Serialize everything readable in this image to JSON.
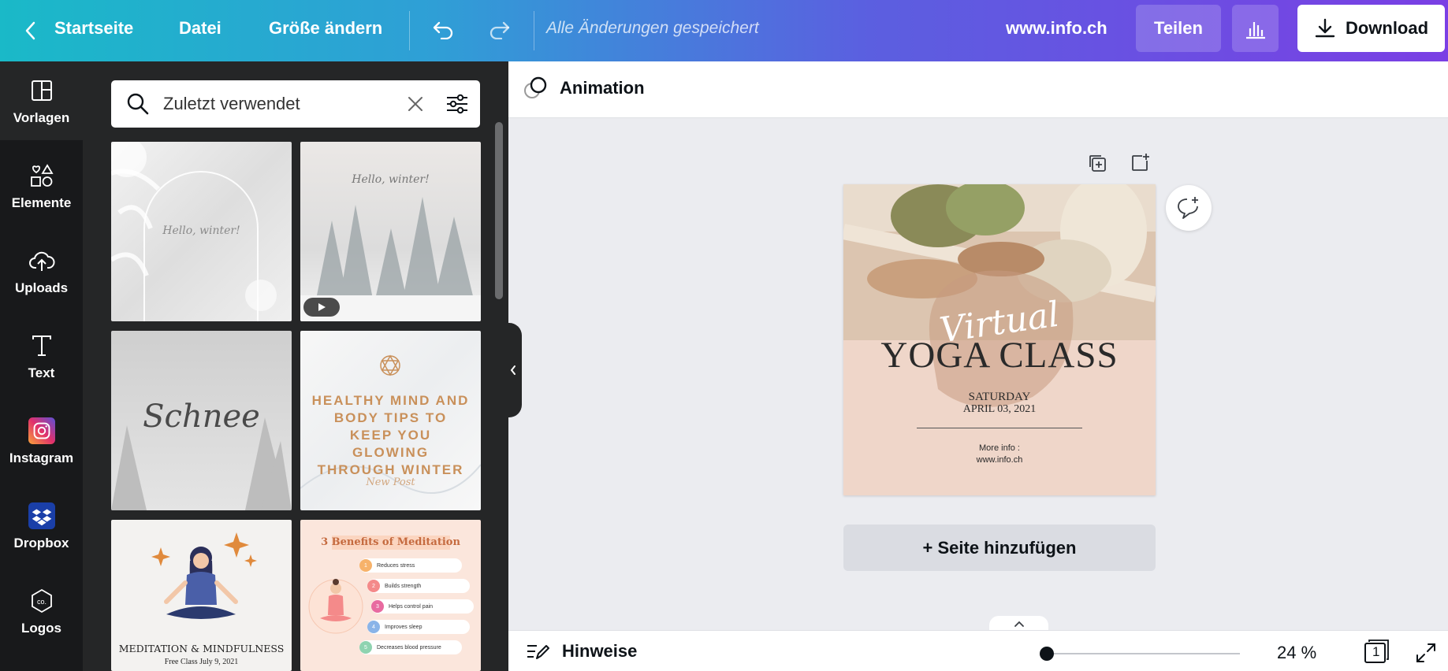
{
  "topbar": {
    "home_label": "Startseite",
    "file_label": "Datei",
    "resize_label": "Größe ändern",
    "save_status": "Alle Änderungen gespeichert",
    "site_label": "www.info.ch",
    "share_label": "Teilen",
    "download_label": "Download"
  },
  "rail": {
    "items": [
      {
        "label": "Vorlagen",
        "icon": "layout-icon"
      },
      {
        "label": "Elemente",
        "icon": "elements-icon"
      },
      {
        "label": "Uploads",
        "icon": "cloud-upload-icon"
      },
      {
        "label": "Text",
        "icon": "text-icon"
      },
      {
        "label": "Instagram",
        "icon": "instagram-icon"
      },
      {
        "label": "Dropbox",
        "icon": "dropbox-icon"
      },
      {
        "label": "Logos",
        "icon": "logo-icon"
      }
    ]
  },
  "search": {
    "value": "Zuletzt verwendet"
  },
  "templates": {
    "t1_text": "Hello, winter!",
    "t2_text": "Hello, winter!",
    "t3_text": "Schnee",
    "t4_text": "HEALTHY MIND AND BODY TIPS TO KEEP YOU GLOWING THROUGH WINTER",
    "t4_sub": "New Post",
    "t5_title": "MEDITATION & MINDFULNESS",
    "t5_sub": "Free Class July 9, 2021",
    "t6_title": "3 Benefits of Meditation",
    "t6_items": [
      "Reduces stress",
      "Builds strength",
      "Helps control pain",
      "Improves sleep",
      "Decreases blood pressure"
    ]
  },
  "editor": {
    "animation_label": "Animation",
    "add_page_label": "+ Seite hinzufügen",
    "notes_label": "Hinweise",
    "zoom_label": "24 %",
    "page_count": "1"
  },
  "design": {
    "virtual": "Virtual",
    "title": "YOGA CLASS",
    "day": "SATURDAY",
    "date": "APRIL 03, 2021",
    "more_info": "More info :",
    "url": "www.info.ch"
  },
  "colors": {
    "accent_download_bg": "#ffffff",
    "rail_bg": "#18191b",
    "panel_bg": "#252627",
    "canvas_bg": "#ebecf0"
  }
}
